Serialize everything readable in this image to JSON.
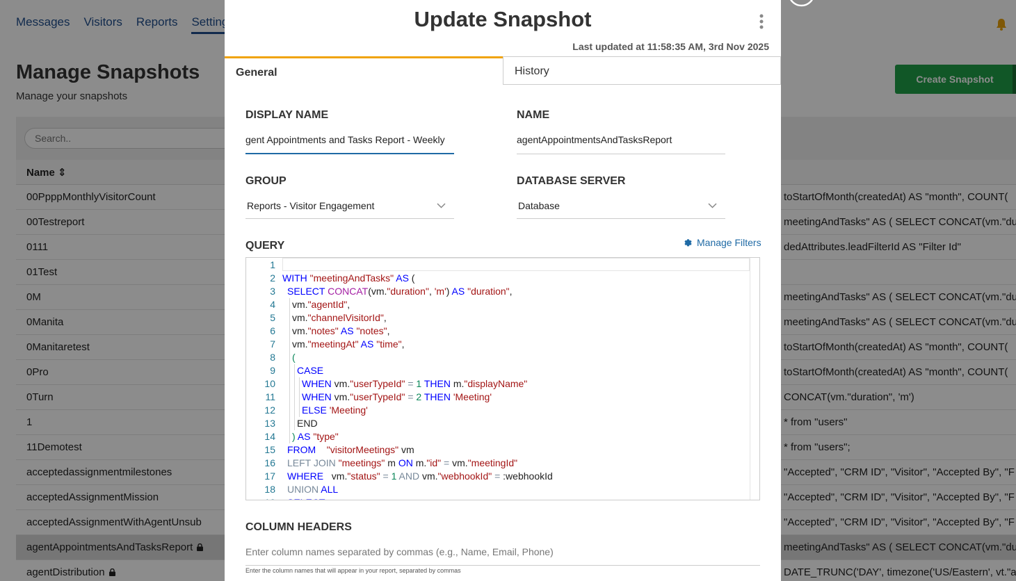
{
  "nav": {
    "items": [
      "Messages",
      "Visitors",
      "Reports",
      "Settings"
    ],
    "active": "Settings"
  },
  "page": {
    "title": "Manage Snapshots",
    "subtitle": "Manage your snapshots",
    "create_button": "Create Snapshot",
    "search_placeholder": "Search..",
    "name_column": "Name ⇕"
  },
  "table": {
    "rows": [
      {
        "name": "00PpppMonthlyVisitorCount",
        "query": "toStartOfMonth(createdAt) AS \"month\", COUNT(",
        "locked": false,
        "selected": false
      },
      {
        "name": "00Testreport",
        "query": "meetingAndTasks\" AS ( SELECT CONCAT(vm.\"dura",
        "locked": false,
        "selected": false
      },
      {
        "name": "0111",
        "query": "dedAttributes.leadFilterId AS \"Filter Id\"",
        "locked": false,
        "selected": false
      },
      {
        "name": "01Test",
        "query": "",
        "locked": false,
        "selected": false
      },
      {
        "name": "0M",
        "query": "meetingAndTasks\" AS ( SELECT CONCAT(vm.\"dura",
        "locked": false,
        "selected": false
      },
      {
        "name": "0Manita",
        "query": "meetingAndTasks\" AS ( SELECT CONCAT(vm.\"dura",
        "locked": false,
        "selected": false
      },
      {
        "name": "0Manitaretest",
        "query": "toStartOfMonth(createdAt) AS \"month\", COUNT(",
        "locked": false,
        "selected": false
      },
      {
        "name": "0Pro",
        "query": "toStartOfMonth(createdAt) AS \"month\", COUNT(",
        "locked": false,
        "selected": false
      },
      {
        "name": "0Turn",
        "query": "CONCAT(vm.\"duration\", 'm')",
        "locked": false,
        "selected": false
      },
      {
        "name": "1",
        "query": "* from \"users\"",
        "locked": false,
        "selected": false
      },
      {
        "name": "11Demotest",
        "query": "* from \"users\";",
        "locked": false,
        "selected": false
      },
      {
        "name": "acceptedassignmentmilestones",
        "query": "\"Accepted\", \"CRM ID\", \"Visitor\", \"Accepted By\", \"F",
        "locked": false,
        "selected": false
      },
      {
        "name": "acceptedAssignmentMission",
        "query": "\"Accepted\", \"CRM ID\", \"Visitor\", \"Accepted By\", \"F",
        "locked": false,
        "selected": false
      },
      {
        "name": "acceptedAssignmentWithAgentUnsub",
        "query": "\"Accepted\", \"CRM ID\", \"Visitor\", \"Accepted By\", \"F",
        "locked": false,
        "selected": false
      },
      {
        "name": "agentAppointmentsAndTasksReport",
        "query": "meetingAndTasks\" AS ( SELECT CONCAT(vm.\"dura",
        "locked": true,
        "selected": true
      },
      {
        "name": "agentDistribution",
        "query": "DATE_TRUNC('DAY', timezone('US/Eastern', vt.\"ac",
        "locked": true,
        "selected": false
      }
    ]
  },
  "modal": {
    "title": "Update Snapshot",
    "last_updated": "Last updated at 11:58:35 AM, 3rd Nov 2025",
    "tabs": {
      "general": "General",
      "history": "History"
    },
    "display_name": {
      "label": "DISPLAY NAME",
      "value": "gent Appointments and Tasks Report - Weekly"
    },
    "name": {
      "label": "NAME",
      "value": "agentAppointmentsAndTasksReport"
    },
    "group": {
      "label": "GROUP",
      "value": "Reports - Visitor Engagement"
    },
    "database_server": {
      "label": "DATABASE SERVER",
      "value": "Database"
    },
    "query": {
      "label": "QUERY",
      "manage_filters": "Manage Filters",
      "lines": [
        {
          "n": "1",
          "indent": 0,
          "tokens": []
        },
        {
          "n": "2",
          "indent": 0,
          "tokens": [
            [
              "kw",
              "WITH "
            ],
            [
              "str",
              "\"meetingAndTasks\""
            ],
            [
              "kw",
              " AS "
            ],
            [
              "plain",
              "("
            ]
          ]
        },
        {
          "n": "3",
          "indent": 1,
          "tokens": [
            [
              "kw",
              "SELECT "
            ],
            [
              "pfn",
              "CONCAT"
            ],
            [
              "plain",
              "(vm."
            ],
            [
              "str",
              "\"duration\""
            ],
            [
              "plain",
              ", "
            ],
            [
              "str",
              "'m'"
            ],
            [
              "plain",
              ") "
            ],
            [
              "kw",
              "AS "
            ],
            [
              "str",
              "\"duration\""
            ],
            [
              "plain",
              ","
            ]
          ]
        },
        {
          "n": "4",
          "indent": 2,
          "tokens": [
            [
              "plain",
              "vm."
            ],
            [
              "str",
              "\"agentId\""
            ],
            [
              "plain",
              ","
            ]
          ]
        },
        {
          "n": "5",
          "indent": 2,
          "tokens": [
            [
              "plain",
              "vm."
            ],
            [
              "str",
              "\"channelVisitorId\""
            ],
            [
              "plain",
              ","
            ]
          ]
        },
        {
          "n": "6",
          "indent": 2,
          "tokens": [
            [
              "plain",
              "vm."
            ],
            [
              "str",
              "\"notes\""
            ],
            [
              "kw",
              " AS "
            ],
            [
              "str",
              "\"notes\""
            ],
            [
              "plain",
              ","
            ]
          ]
        },
        {
          "n": "7",
          "indent": 2,
          "tokens": [
            [
              "plain",
              "vm."
            ],
            [
              "str",
              "\"meetingAt\""
            ],
            [
              "kw",
              " AS "
            ],
            [
              "str",
              "\"time\""
            ],
            [
              "plain",
              ","
            ]
          ]
        },
        {
          "n": "8",
          "indent": 2,
          "tokens": [
            [
              "num",
              "("
            ]
          ]
        },
        {
          "n": "9",
          "indent": 3,
          "tokens": [
            [
              "kw",
              "CASE"
            ]
          ]
        },
        {
          "n": "10",
          "indent": 4,
          "tokens": [
            [
              "kw",
              "WHEN "
            ],
            [
              "plain",
              "vm."
            ],
            [
              "str",
              "\"userTypeId\""
            ],
            [
              "op",
              " = "
            ],
            [
              "num",
              "1"
            ],
            [
              "kw",
              " THEN "
            ],
            [
              "plain",
              "m."
            ],
            [
              "str",
              "\"displayName\""
            ]
          ]
        },
        {
          "n": "11",
          "indent": 4,
          "tokens": [
            [
              "kw",
              "WHEN "
            ],
            [
              "plain",
              "vm."
            ],
            [
              "str",
              "\"userTypeId\""
            ],
            [
              "op",
              " = "
            ],
            [
              "num",
              "2"
            ],
            [
              "kw",
              " THEN "
            ],
            [
              "str",
              "'Meeting'"
            ]
          ]
        },
        {
          "n": "12",
          "indent": 4,
          "tokens": [
            [
              "kw",
              "ELSE "
            ],
            [
              "str",
              "'Meeting'"
            ]
          ]
        },
        {
          "n": "13",
          "indent": 3,
          "tokens": [
            [
              "plain",
              "END"
            ]
          ]
        },
        {
          "n": "14",
          "indent": 2,
          "tokens": [
            [
              "num",
              ")"
            ],
            [
              "kw",
              " AS "
            ],
            [
              "str",
              "\"type\""
            ]
          ]
        },
        {
          "n": "15",
          "indent": 1,
          "tokens": [
            [
              "kw",
              "FROM    "
            ],
            [
              "str",
              "\"visitorMeetings\""
            ],
            [
              "plain",
              " vm"
            ]
          ]
        },
        {
          "n": "16",
          "indent": 1,
          "tokens": [
            [
              "op",
              "LEFT JOIN "
            ],
            [
              "str",
              "\"meetings\""
            ],
            [
              "plain",
              " m "
            ],
            [
              "kw",
              "ON "
            ],
            [
              "plain",
              "m."
            ],
            [
              "str",
              "\"id\""
            ],
            [
              "op",
              " = "
            ],
            [
              "plain",
              "vm."
            ],
            [
              "str",
              "\"meetingId\""
            ]
          ]
        },
        {
          "n": "17",
          "indent": 1,
          "tokens": [
            [
              "kw",
              "WHERE   "
            ],
            [
              "plain",
              "vm."
            ],
            [
              "str",
              "\"status\""
            ],
            [
              "op",
              " = "
            ],
            [
              "num",
              "1"
            ],
            [
              "op",
              " AND "
            ],
            [
              "plain",
              "vm."
            ],
            [
              "str",
              "\"webhookId\""
            ],
            [
              "op",
              " = "
            ],
            [
              "plain",
              ":webhookId"
            ]
          ]
        },
        {
          "n": "18",
          "indent": 1,
          "tokens": [
            [
              "op",
              "UNION "
            ],
            [
              "kw",
              "ALL"
            ]
          ]
        },
        {
          "n": "19",
          "indent": 1,
          "tokens": [
            [
              "kw",
              "SELECT"
            ]
          ]
        }
      ]
    },
    "column_headers": {
      "label": "COLUMN HEADERS",
      "placeholder": "Enter column names separated by commas (e.g., Name, Email, Phone)",
      "help": "Enter the column names that will appear in your report, separated by commas"
    }
  },
  "colors": {
    "accent_tab": "#f0a30a",
    "link": "#1f6aa5",
    "create_button": "#1f9e47",
    "nav_text": "#1f4e8c"
  }
}
